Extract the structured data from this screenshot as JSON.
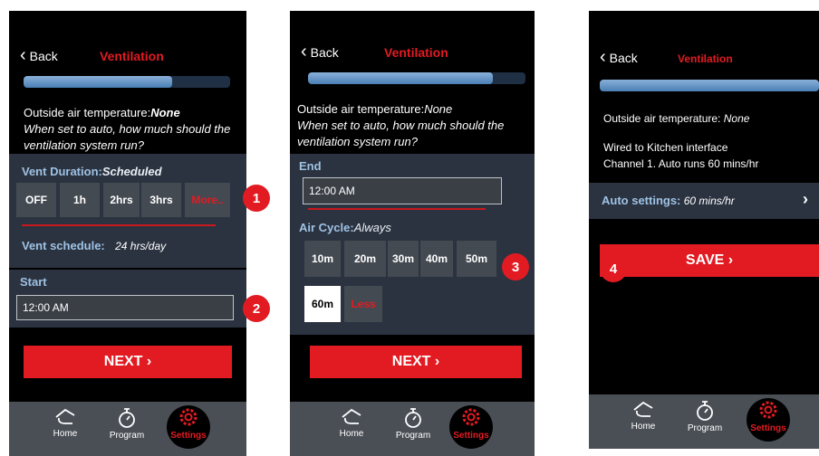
{
  "screens": [
    {
      "back_label": "Back",
      "title": "Ventilation",
      "progress": 0.72,
      "outside_air_label": "Outside air temperature:",
      "outside_air_value": "None",
      "question": "When set to auto, how much should the ventilation system run?",
      "vent_duration_label": "Vent Duration:",
      "vent_duration_value": "Scheduled",
      "duration_options": [
        "OFF",
        "1h",
        "2hrs",
        "3hrs",
        "More.."
      ],
      "vent_schedule_label": "Vent schedule:",
      "vent_schedule_value": "24 hrs/day",
      "start_label": "Start",
      "start_value": "12:00 AM",
      "next_label": "NEXT  ›",
      "nav": [
        "Home",
        "Program",
        "Settings"
      ]
    },
    {
      "back_label": "Back",
      "title": "Ventilation",
      "progress": 0.85,
      "outside_air_label": "Outside air temperature:",
      "outside_air_value": "None",
      "question": "When set to auto, how much should the ventilation system run?",
      "end_label": "End",
      "end_value": "12:00 AM",
      "air_cycle_label": "Air Cycle:",
      "air_cycle_value": "Always",
      "cycle_options": [
        "10m",
        "20m",
        "30m",
        "40m",
        "50m",
        "60m",
        "Less"
      ],
      "next_label": "NEXT  ›",
      "nav": [
        "Home",
        "Program",
        "Settings"
      ]
    },
    {
      "back_label": "Back",
      "title": "Ventilation",
      "progress": 1.0,
      "outside_air_label": "Outside air temperature:",
      "outside_air_value": "None",
      "wired_line1": "Wired to Kitchen interface",
      "wired_line2": "Channel 1. Auto runs 60 mins/hr",
      "auto_settings_label": "Auto settings:",
      "auto_settings_value": "60 mins/hr",
      "save_label": "SAVE  ›",
      "nav": [
        "Home",
        "Program",
        "Settings"
      ]
    }
  ],
  "badges": [
    "1",
    "2",
    "3",
    "4"
  ],
  "colors": {
    "accent": "#e21b22",
    "label_blue": "#9fc2e4",
    "panel": "#2b3340",
    "navbar": "#4a4f56"
  }
}
